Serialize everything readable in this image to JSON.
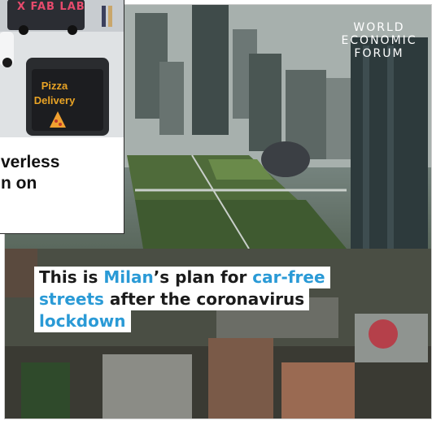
{
  "logo": {
    "lines": [
      "WORLD",
      "ECONOMIC",
      "FORUM"
    ],
    "color": "#ffffff"
  },
  "caption": {
    "line1": {
      "text_a": "This is ",
      "highlight": "Milan",
      "text_b": "’s plan for ",
      "highlight2": "car-free"
    },
    "line2": {
      "highlight": "streets",
      "text": " after the coronavirus"
    },
    "line3": {
      "highlight": "lockdown"
    },
    "highlight_color": "#2a9ad6",
    "text_color": "#1b1b1b"
  },
  "inset": {
    "brand_text": "X FAB LAB",
    "sign_line1": "Pizza",
    "sign_line2": "Delivery",
    "caption_line1": "verless",
    "caption_line2": "n on"
  }
}
